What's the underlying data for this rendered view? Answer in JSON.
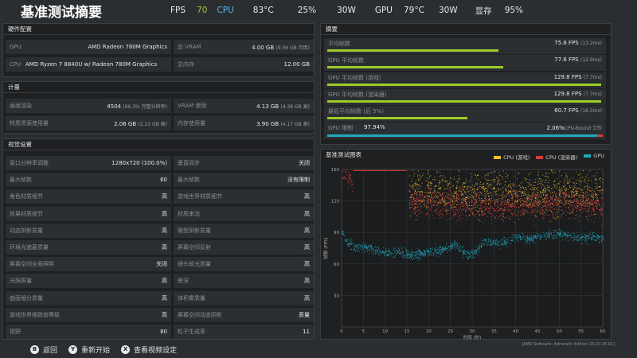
{
  "header": {
    "title": "基准测试摘要",
    "stats": [
      {
        "label": "FPS",
        "color": "#e8e8e8"
      },
      {
        "label": "70",
        "color": "#9ccd2a"
      },
      {
        "label": "CPU",
        "color": "#5ab4ea"
      },
      {
        "label": "83°C",
        "color": "#e8e8e8"
      },
      {
        "label": "25%",
        "color": "#e8e8e8"
      },
      {
        "label": "30W",
        "color": "#e8e8e8"
      },
      {
        "label": "GPU",
        "color": "#e8e8e8"
      },
      {
        "label": "79°C",
        "color": "#e8e8e8"
      },
      {
        "label": "30W",
        "color": "#e8e8e8"
      },
      {
        "label": "显存",
        "color": "#e8e8e8"
      },
      {
        "label": "95%",
        "color": "#e8e8e8"
      }
    ]
  },
  "hardware": {
    "title": "硬件配置",
    "gpu_label": "GPU",
    "gpu_value": "AMD Radeon 780M Graphics",
    "cpu_label": "CPU",
    "cpu_value": "AMD Ryzen 7 8840U w/ Radeon 780M Graphics",
    "vram_label": "总 VRAM",
    "vram_value": "4.00 GB",
    "vram_sub": "(9.06 GB 可用)",
    "mem_label": "总内存",
    "mem_value": "12.00 GB"
  },
  "metrics": {
    "title": "计量",
    "frames_label": "画面渲染",
    "frames_value": "4504",
    "frames_sub": "(99.3% 完整分辨率)",
    "vram_used_label": "VRAM 使用",
    "vram_used_value": "4.13 GB",
    "vram_used_sub": "(4.38 GB 高)",
    "stream_label": "材质资源使用量",
    "stream_value": "2.06 GB",
    "stream_sub": "(2.23 GB 高)",
    "mem_used_label": "内存使用量",
    "mem_used_value": "3.90 GB",
    "mem_used_sub": "(4.17 GB 高)"
  },
  "visual": {
    "title": "视觉设置",
    "left": [
      {
        "k": "窗口分辨率调整",
        "v": "1280x720 (100.0%)"
      },
      {
        "k": "最大帧数",
        "v": "60"
      },
      {
        "k": "角色材质细节",
        "v": "高"
      },
      {
        "k": "效果材质细节",
        "v": "高"
      },
      {
        "k": "动态阴影质量",
        "v": "高"
      },
      {
        "k": "环境光遮蔽质量",
        "v": "高"
      },
      {
        "k": "屏幕空间全局照明",
        "v": "关闭"
      },
      {
        "k": "光照质量",
        "v": "高"
      },
      {
        "k": "曲面细分质量",
        "v": "高"
      },
      {
        "k": "游戏世界细致度等级",
        "v": "高"
      },
      {
        "k": "视野",
        "v": "80"
      }
    ],
    "right": [
      {
        "k": "垂直同步",
        "v": "关闭"
      },
      {
        "k": "最大帧数",
        "v": "没有限制"
      },
      {
        "k": "游戏世界材质细节",
        "v": "高"
      },
      {
        "k": "材质串流",
        "v": "高"
      },
      {
        "k": "微型阴影质量",
        "v": "高"
      },
      {
        "k": "屏幕空间反射",
        "v": "高"
      },
      {
        "k": "镜头眩光质量",
        "v": "高"
      },
      {
        "k": "景深",
        "v": "高"
      },
      {
        "k": "体积雾质量",
        "v": "高"
      },
      {
        "k": "屏幕空间动态阴影",
        "v": "质量"
      },
      {
        "k": "粒子生成率",
        "v": "11"
      }
    ]
  },
  "summary": {
    "title": "摘要",
    "rows": [
      {
        "label": "平均帧数",
        "value": "75.6 FPS",
        "sub": "(13.2ms)",
        "fill": 0.62
      },
      {
        "label": "GPU 平均帧数",
        "value": "77.6 FPS",
        "sub": "(12.9ms)",
        "fill": 0.64
      },
      {
        "label": "GPU 平均帧数 (游戏)",
        "value": "129.8 FPS",
        "sub": "(7.7ms)",
        "fill": 0.995
      },
      {
        "label": "GPU 平均帧数 (渲染器)",
        "value": "129.8 FPS",
        "sub": "(7.7ms)",
        "fill": 0.995
      },
      {
        "label": "最低平均帧数 (后 5%)",
        "value": "60.7 FPS",
        "sub": "(16.5ms)",
        "fill": 0.51
      }
    ],
    "gpu_bound_label": "GPU 限制",
    "gpu_bound_value": "97.94%",
    "cpu_bound_value": "2.06%",
    "cpu_bound_label": "CPU-Bound 工作",
    "gpu_fill": 0.9794
  },
  "chart_panel_title": "基准测试图表",
  "chart_data": {
    "type": "scatter",
    "title": "",
    "xlabel": "时间 (秒)",
    "ylabel": "帧数 (FPS)",
    "xlim": [
      0,
      60
    ],
    "ylim": [
      0,
      150
    ],
    "xticks": [
      0,
      5,
      10,
      15,
      20,
      25,
      30,
      35,
      40,
      45,
      50,
      55,
      60
    ],
    "yticks": [
      30,
      60,
      90,
      120,
      150
    ],
    "grid": true,
    "legend_position": "top-right",
    "series": [
      {
        "name": "CPU (游戏)",
        "color": "#f2c232",
        "segments": [
          {
            "x": [
              15.5,
              20,
              25,
              30,
              35,
              40,
              45,
              50,
              55,
              60
            ],
            "y": [
              128,
              133,
              129,
              127,
              131,
              128,
              126,
              130,
              128,
              127
            ],
            "spread": 10,
            "count": 1300
          }
        ]
      },
      {
        "name": "CPU (渲染器)",
        "color": "#e03a3a",
        "segments": [
          {
            "x": [
              0,
              2,
              2.6
            ],
            "y": [
              148,
              142,
              134
            ],
            "spread": 4,
            "count": 50
          },
          {
            "x": [
              2.6,
              5,
              10,
              14.9
            ],
            "y": [
              149,
              149.6,
              149.6,
              149.6
            ],
            "spread": 0.5,
            "count": 12,
            "line": true
          },
          {
            "x": [
              15.5,
              20,
              25,
              30,
              35,
              40,
              45,
              50,
              55,
              60
            ],
            "y": [
              120,
              118,
              116,
              117,
              115,
              117,
              116,
              118,
              117,
              116
            ],
            "spread": 7,
            "count": 1300
          }
        ]
      },
      {
        "name": "GPU",
        "color": "#20a7bd",
        "segments": [
          {
            "x": [
              0,
              1.5,
              3,
              5,
              7,
              10,
              13,
              15,
              17,
              20,
              23,
              26,
              29,
              31,
              33,
              35,
              37,
              40,
              43,
              46,
              49,
              52,
              55,
              58,
              60
            ],
            "y": [
              92,
              79,
              76,
              77,
              74,
              71,
              72,
              69,
              69,
              72,
              73,
              79,
              69,
              72,
              83,
              80,
              80,
              86,
              84,
              87,
              89,
              87,
              84,
              87,
              84
            ],
            "spread": 2.2,
            "count": 1200
          }
        ]
      }
    ]
  },
  "footer": {
    "back_key": "B",
    "back_label": "返回",
    "restart_key": "Y",
    "restart_label": "重新开始",
    "settings_key": "X",
    "settings_label": "查看视频设定",
    "version": "[AMD Software: Adrenalin Edition 24.10.38.01]"
  }
}
